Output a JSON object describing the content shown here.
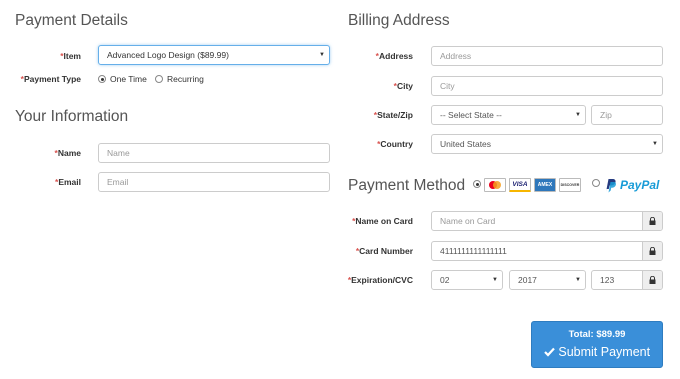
{
  "payment_details": {
    "heading": "Payment Details",
    "item_label": "Item",
    "item_value": "Advanced Logo Design ($89.99)",
    "payment_type_label": "Payment Type",
    "options": [
      "One Time",
      "Recurring"
    ],
    "selected": "One Time"
  },
  "your_information": {
    "heading": "Your Information",
    "name_label": "Name",
    "name_placeholder": "Name",
    "email_label": "Email",
    "email_placeholder": "Email"
  },
  "billing": {
    "heading": "Billing Address",
    "address_label": "Address",
    "address_placeholder": "Address",
    "city_label": "City",
    "city_placeholder": "City",
    "state_zip_label": "State/Zip",
    "state_value": "-- Select State --",
    "zip_placeholder": "Zip",
    "country_label": "Country",
    "country_value": "United States"
  },
  "payment_method": {
    "heading": "Payment Method",
    "cards": [
      "MasterCard",
      "VISA",
      "AMEX",
      "DISCOVER"
    ],
    "paypal_text": "PayPal",
    "selected": "cards",
    "name_on_card_label": "Name on Card",
    "name_on_card_placeholder": "Name on Card",
    "card_number_label": "Card Number",
    "card_number_value": "4111111111111111",
    "expiration_label": "Expiration/CVC",
    "month_value": "02",
    "year_value": "2017",
    "cvc_value": "123"
  },
  "submit": {
    "total_label": "Total: $89.99",
    "button_label": "Submit Payment"
  },
  "colors": {
    "required": "#d9534f",
    "button": "#3a8fd9",
    "paypal_dark": "#253b80",
    "paypal_light": "#179bd7"
  }
}
